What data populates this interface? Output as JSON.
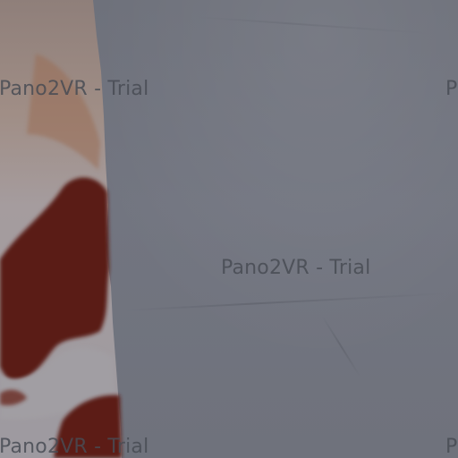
{
  "watermarks": {
    "text": "Pano2VR - Trial",
    "text_cut_right": "P"
  },
  "palette": {
    "wall": "#71747e",
    "fur_white": "#b9b8bd",
    "fur_brown": "#5a1a14",
    "fur_tan": "#9a6d55",
    "watermark": "#484b54"
  }
}
